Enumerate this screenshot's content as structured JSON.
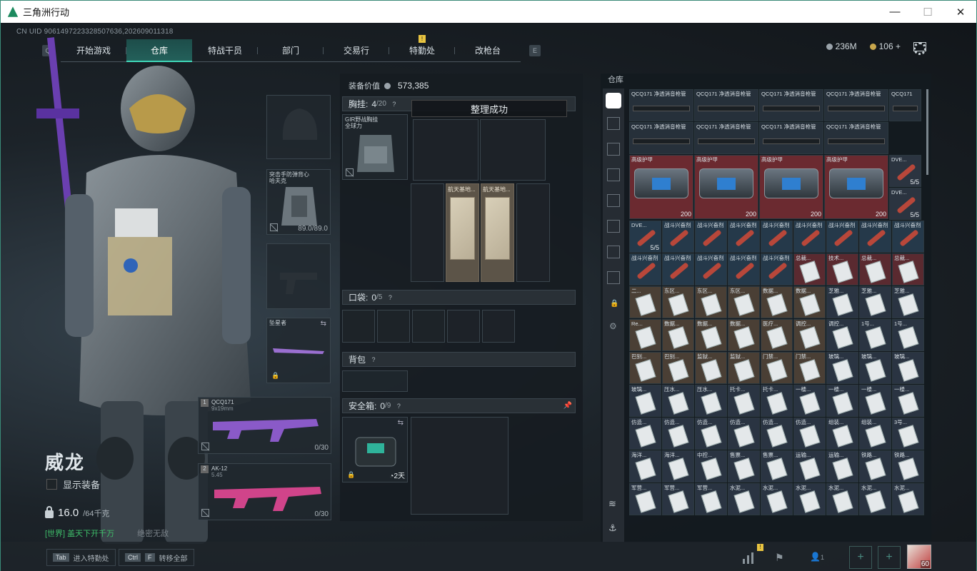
{
  "window": {
    "title": "三角洲行动",
    "min": "—",
    "max": "☐",
    "close": "✕"
  },
  "uid": "CN UID 9061497223328507636,202609011318",
  "nav": {
    "left_key": "Q",
    "right_key": "E",
    "tabs": [
      "开始游戏",
      "仓库",
      "特战干员",
      "部门",
      "交易行",
      "特勤处",
      "改枪台"
    ],
    "active": "仓库",
    "badge": "!"
  },
  "currency": {
    "silver": "236M",
    "gold": "106",
    "plus": "+"
  },
  "operator": {
    "name": "威龙",
    "show_gear": "显示装备",
    "weight": "16.0",
    "weight_cap": "/64千克",
    "chat": "[世界] 盖天下开千万",
    "chat2": "绝密无敌"
  },
  "loadout": {
    "vest_label": "突击手防弹背心",
    "vest_label2": "哈夫克",
    "vest_durability": "89.0/89.0",
    "melee_label": "坠星者",
    "weapon1": {
      "slot": "1",
      "name": "QCQ171",
      "ammo_type": "9x19mm",
      "ammo": "0/30"
    },
    "weapon2": {
      "slot": "2",
      "name": "AK-12",
      "ammo_type": "5.45",
      "ammo": "0/30"
    }
  },
  "equipment": {
    "value_label": "装备价值",
    "value": "573,385",
    "chest_label": "胸挂:",
    "chest_count": "4",
    "chest_cap": "/20",
    "chest_item": "GIR野战胸挂",
    "chest_item2": "全球力",
    "pocket_label": "口袋:",
    "pocket_count": "0",
    "pocket_cap": "/5",
    "backpack_label": "背包",
    "safebox_label": "安全箱:",
    "safebox_count": "0",
    "safebox_cap": "/9",
    "safebox_time": "2天",
    "map_item": "航天基地..."
  },
  "toast": "整理成功",
  "warehouse": {
    "title": "仓库",
    "rows": [
      [
        "QCQ171 净透消音枪管",
        "QCQ171 净透消音枪管",
        "QCQ171 净透消音枪管",
        "QCQ171 净透消音枪管",
        "QCQ171"
      ],
      [
        "QCQ171 净透消音枪管",
        "QCQ171 净透消音枪管",
        "QCQ171 净透消音枪管",
        "QCQ171 净透消音枪管",
        ""
      ],
      [
        "高级护甲",
        "高级护甲",
        "高级护甲",
        "高级护甲",
        "DVE..."
      ],
      [
        "DVE...",
        "战斗兴奋剂",
        "战斗兴奋剂",
        "战斗兴奋剂",
        "战斗兴奋剂",
        "战斗兴奋剂",
        "战斗兴奋剂",
        "战斗兴奋剂",
        "战斗兴奋剂"
      ],
      [
        "战斗兴奋剂",
        "战斗兴奋剂",
        "战斗兴奋剂",
        "战斗兴奋剂",
        "战斗兴奋剂",
        "总裁...",
        "技术...",
        "总裁...",
        "总裁..."
      ],
      [
        "二...",
        "东区...",
        "东区...",
        "东区...",
        "数据...",
        "数据...",
        "芝雅...",
        "芝雅...",
        "芝雅..."
      ],
      [
        "Re...",
        "数据...",
        "数据...",
        "数据...",
        "医疗...",
        "调控...",
        "调控...",
        "1号...",
        "1号..."
      ],
      [
        "巴别...",
        "巴别...",
        "监狱...",
        "监狱...",
        "门禁...",
        "门禁...",
        "玻璃...",
        "玻璃...",
        "玻璃..."
      ],
      [
        "玻璃...",
        "压水...",
        "压水...",
        "托卡...",
        "托卡...",
        "一楼...",
        "一楼...",
        "一楼...",
        "一楼..."
      ],
      [
        "仿造...",
        "仿造...",
        "仿造...",
        "仿造...",
        "仿造...",
        "仿造...",
        "组装...",
        "组装...",
        "3号..."
      ],
      [
        "海洋...",
        "海洋...",
        "中控...",
        "售票...",
        "售票...",
        "运输...",
        "运输...",
        "铁路...",
        "铁路..."
      ],
      [
        "军营...",
        "军营...",
        "军营...",
        "水泥...",
        "水泥...",
        "水泥...",
        "水泥...",
        "水泥...",
        "水泥..."
      ]
    ],
    "counts": {
      "armor": "200",
      "dve": "5/5",
      "dve_small": "5/5"
    }
  },
  "bottom": {
    "tab_key": "Tab",
    "tab_label": "进入特勤处",
    "ctrl_key": "Ctrl",
    "f_key": "F",
    "ctrl_label": "转移全部",
    "friends": "1",
    "level": "60",
    "badge": "!"
  },
  "colors": {
    "accent": "#3fd6b8",
    "armor_bg": "#6b2a30",
    "stim_bg": "#25394a",
    "key_bg": "#4a3f35",
    "card_bg": "#2a3442"
  }
}
